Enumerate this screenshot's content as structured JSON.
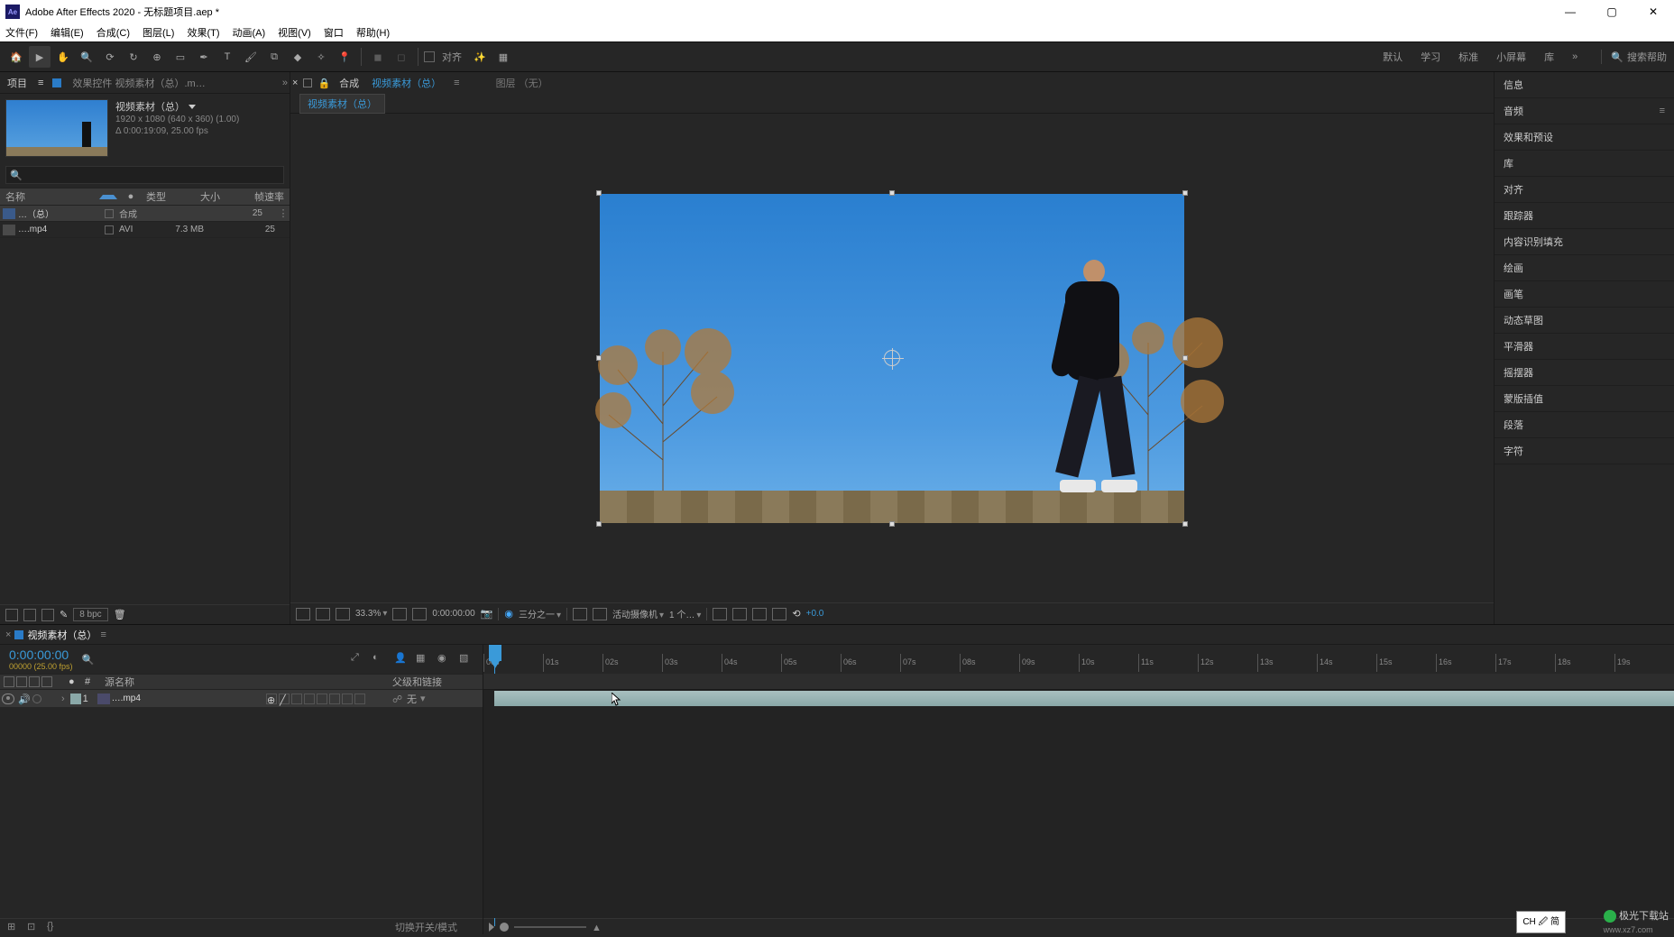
{
  "window": {
    "title": "Adobe After Effects 2020 - 无标题项目.aep *",
    "app_icon_label": "Ae"
  },
  "menu": [
    "文件(F)",
    "编辑(E)",
    "合成(C)",
    "图层(L)",
    "效果(T)",
    "动画(A)",
    "视图(V)",
    "窗口",
    "帮助(H)"
  ],
  "toolbar": {
    "snap_label": "对齐",
    "workspaces": [
      "默认",
      "学习",
      "标准",
      "小屏幕",
      "库"
    ],
    "search_placeholder": "搜索帮助"
  },
  "project": {
    "panel_title": "项目",
    "effect_tab": "效果控件 视频素材（总）.m…",
    "comp_name": "视频素材（总）",
    "res_line": "1920 x 1080 (640 x 360) (1.00)",
    "dur_line": "Δ 0:00:19:09, 25.00 fps",
    "cols": {
      "name": "名称",
      "type": "类型",
      "size": "大小",
      "fr": "帧速率"
    },
    "rows": [
      {
        "name": "…（总）",
        "type": "合成",
        "size": "",
        "fr": "25"
      },
      {
        "name": "….mp4",
        "type": "AVI",
        "size": "7.3 MB",
        "fr": "25"
      }
    ],
    "bpc": "8 bpc"
  },
  "composition": {
    "comp_label": "合成",
    "comp_name": "视频素材（总）",
    "layer_label": "图层 （无）",
    "flow_tab": "视频素材（总）"
  },
  "viewer_footer": {
    "zoom": "33.3%",
    "timecode": "0:00:00:00",
    "res": "三分之一",
    "camera": "活动摄像机",
    "views": "1 个…",
    "exposure": "+0.0"
  },
  "right_panels": [
    "信息",
    "音频",
    "效果和预设",
    "库",
    "对齐",
    "跟踪器",
    "内容识别填充",
    "绘画",
    "画笔",
    "动态草图",
    "平滑器",
    "摇摆器",
    "蒙版插值",
    "段落",
    "字符"
  ],
  "timeline": {
    "tab": "视频素材（总）",
    "timecode": "0:00:00:00",
    "sub": "00000 (25.00 fps)",
    "col_source": "源名称",
    "col_parent": "父级和链接",
    "layer": {
      "index": "1",
      "name": "….mp4",
      "parent": "无"
    },
    "ruler": [
      "00s",
      "01s",
      "02s",
      "03s",
      "04s",
      "05s",
      "06s",
      "07s",
      "08s",
      "09s",
      "10s",
      "11s",
      "12s",
      "13s",
      "14s",
      "15s",
      "16s",
      "17s",
      "18s",
      "19s"
    ],
    "footer_label": "切换开关/模式"
  },
  "ime": "CH 🖉 简",
  "watermark": {
    "site": "极光下载站",
    "url": "www.xz7.com"
  }
}
